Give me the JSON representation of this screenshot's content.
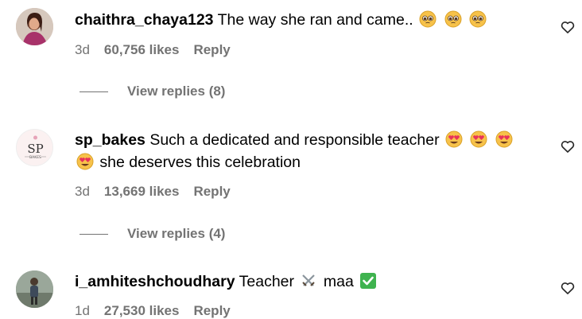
{
  "comments": [
    {
      "username": "chaithra_chaya123",
      "text": "The way she ran and came..",
      "age": "3d",
      "likes": "60,756 likes",
      "reply_label": "Reply",
      "view_replies": "View replies (8)",
      "emoji_icons": [
        "pleading-face-icon",
        "pleading-face-icon",
        "pleading-face-icon"
      ]
    },
    {
      "username": "sp_bakes",
      "text": "Such a dedicated and responsible teacher",
      "text2": "she deserves this celebration",
      "age": "3d",
      "likes": "13,669 likes",
      "reply_label": "Reply",
      "view_replies": "View replies (4)",
      "avatar_text": "SP",
      "avatar_subtext": "BAKES",
      "emoji_icons": [
        "heart-eyes-icon",
        "heart-eyes-icon",
        "heart-eyes-icon",
        "heart-eyes-icon"
      ]
    },
    {
      "username": "i_amhiteshchoudhary",
      "text_before": "Teacher",
      "text_after": "maa",
      "age": "1d",
      "likes": "27,530 likes",
      "reply_label": "Reply",
      "emoji_icons": [
        "crossed-swords-icon",
        "check-mark-button-icon"
      ]
    }
  ],
  "colors": {
    "secondary_text": "#737373",
    "primary_text": "#000000"
  }
}
